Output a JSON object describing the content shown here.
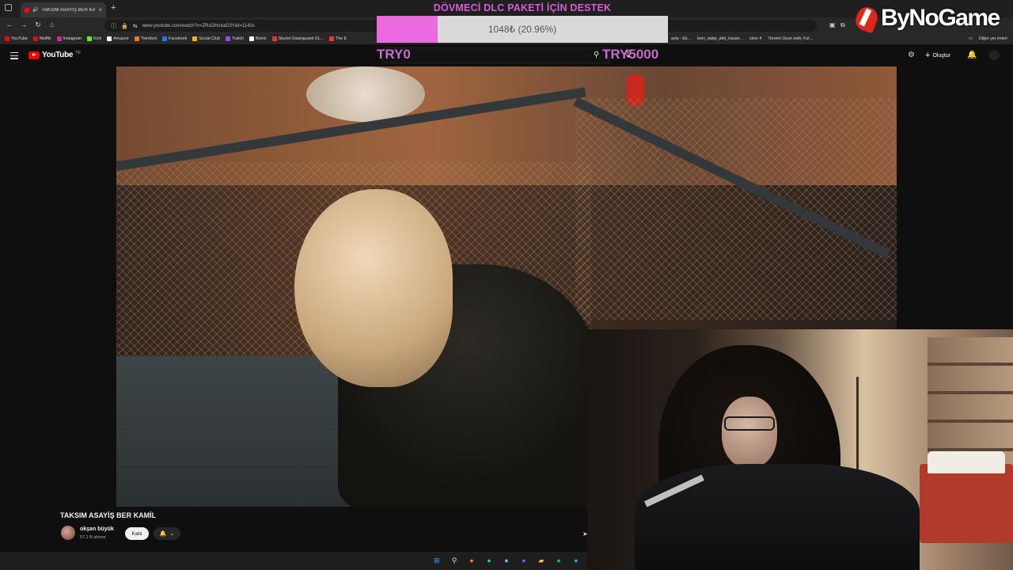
{
  "browser": {
    "tab_title": "TAKSİM ASAYİŞ BER KAMİL",
    "new_tab": "+",
    "url": "www.youtube.com/watch?v=ZRsOHckaO3Y&t=1143s",
    "bookmarks": [
      {
        "label": "YouTube",
        "color": "#ff0000"
      },
      {
        "label": "Netflix",
        "color": "#e50914"
      },
      {
        "label": "Instagram",
        "color": "#d6249f"
      },
      {
        "label": "Kick",
        "color": "#53fc18"
      },
      {
        "label": "Amazon",
        "color": "#ffffff"
      },
      {
        "label": "Trendyol",
        "color": "#f27a1a"
      },
      {
        "label": "Facebook",
        "color": "#1877f2"
      },
      {
        "label": "Social Club",
        "color": "#fcaf17"
      },
      {
        "label": "Twitch",
        "color": "#9146ff"
      },
      {
        "label": "Botrix",
        "color": "#ffffff"
      },
      {
        "label": "Skyrim Dawnguard DL...",
        "color": "#e33"
      },
      {
        "label": "The E",
        "color": "#e33"
      }
    ],
    "bookmarks_right": [
      {
        "label": "asty - Ek..."
      },
      {
        "label": "borc_takip_afet_hasan..."
      },
      {
        "label": "sims 4"
      },
      {
        "label": "Torrent Oyun indir, Ful..."
      }
    ],
    "other_bookmarks": "Diğer yer imleri"
  },
  "youtube": {
    "logo_text": "YouTube",
    "country": "TR",
    "create_label": "Oluştur",
    "video_title": "TAKSIM ASAYİŞ BER KAMİL",
    "channel_name": "okşan büyük",
    "subscribers": "57,2 B abone",
    "join_label": "Katıl",
    "notif_chevron": "⌄"
  },
  "overlay": {
    "donation_title": "DÖVMECİ DLC PAKETİ İÇİN DESTEK",
    "donation_amount": "1048₺ (20.96%)",
    "donation_progress": 0.2096,
    "goal_min": "TRY0",
    "goal_max": "TRY5000",
    "accent": "#d65cd6"
  },
  "brand": {
    "text": "ByNoGame"
  },
  "taskbar_icons": [
    "windows-icon",
    "search-icon",
    "firefox-icon",
    "whatsapp-icon",
    "steam-icon",
    "discord-icon",
    "folder-icon",
    "spotify-icon",
    "edge-icon"
  ]
}
